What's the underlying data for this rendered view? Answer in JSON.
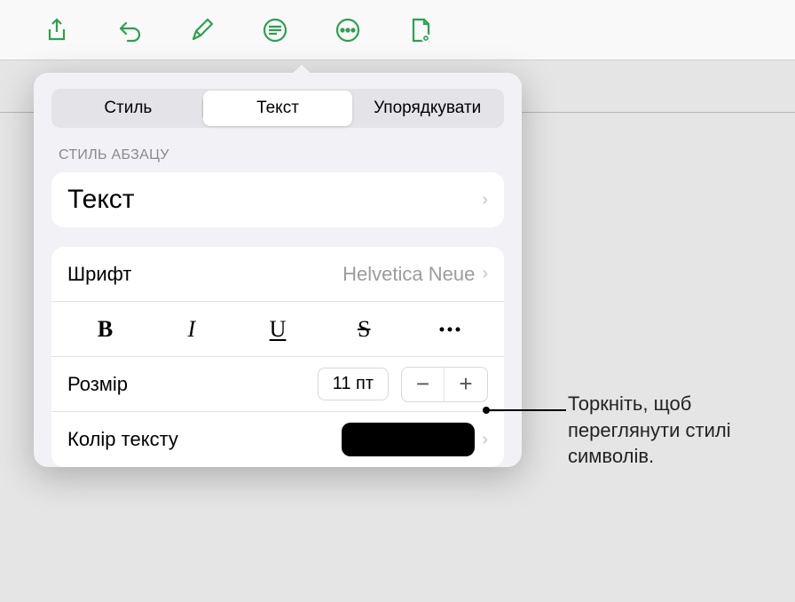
{
  "tabs": {
    "style": "Стиль",
    "text": "Текст",
    "arrange": "Упорядкувати"
  },
  "paragraph_section": {
    "header": "СТИЛЬ АБЗАЦУ",
    "style_name": "Текст"
  },
  "font": {
    "label": "Шрифт",
    "value": "Helvetica Neue"
  },
  "size": {
    "label": "Розмір",
    "value": "11 пт"
  },
  "text_color": {
    "label": "Колір тексту",
    "value": "#000000"
  },
  "style_buttons": {
    "bold": "B",
    "italic": "I",
    "underline": "U",
    "strike": "S"
  },
  "callout": "Торкніть, щоб переглянути стилі символів."
}
